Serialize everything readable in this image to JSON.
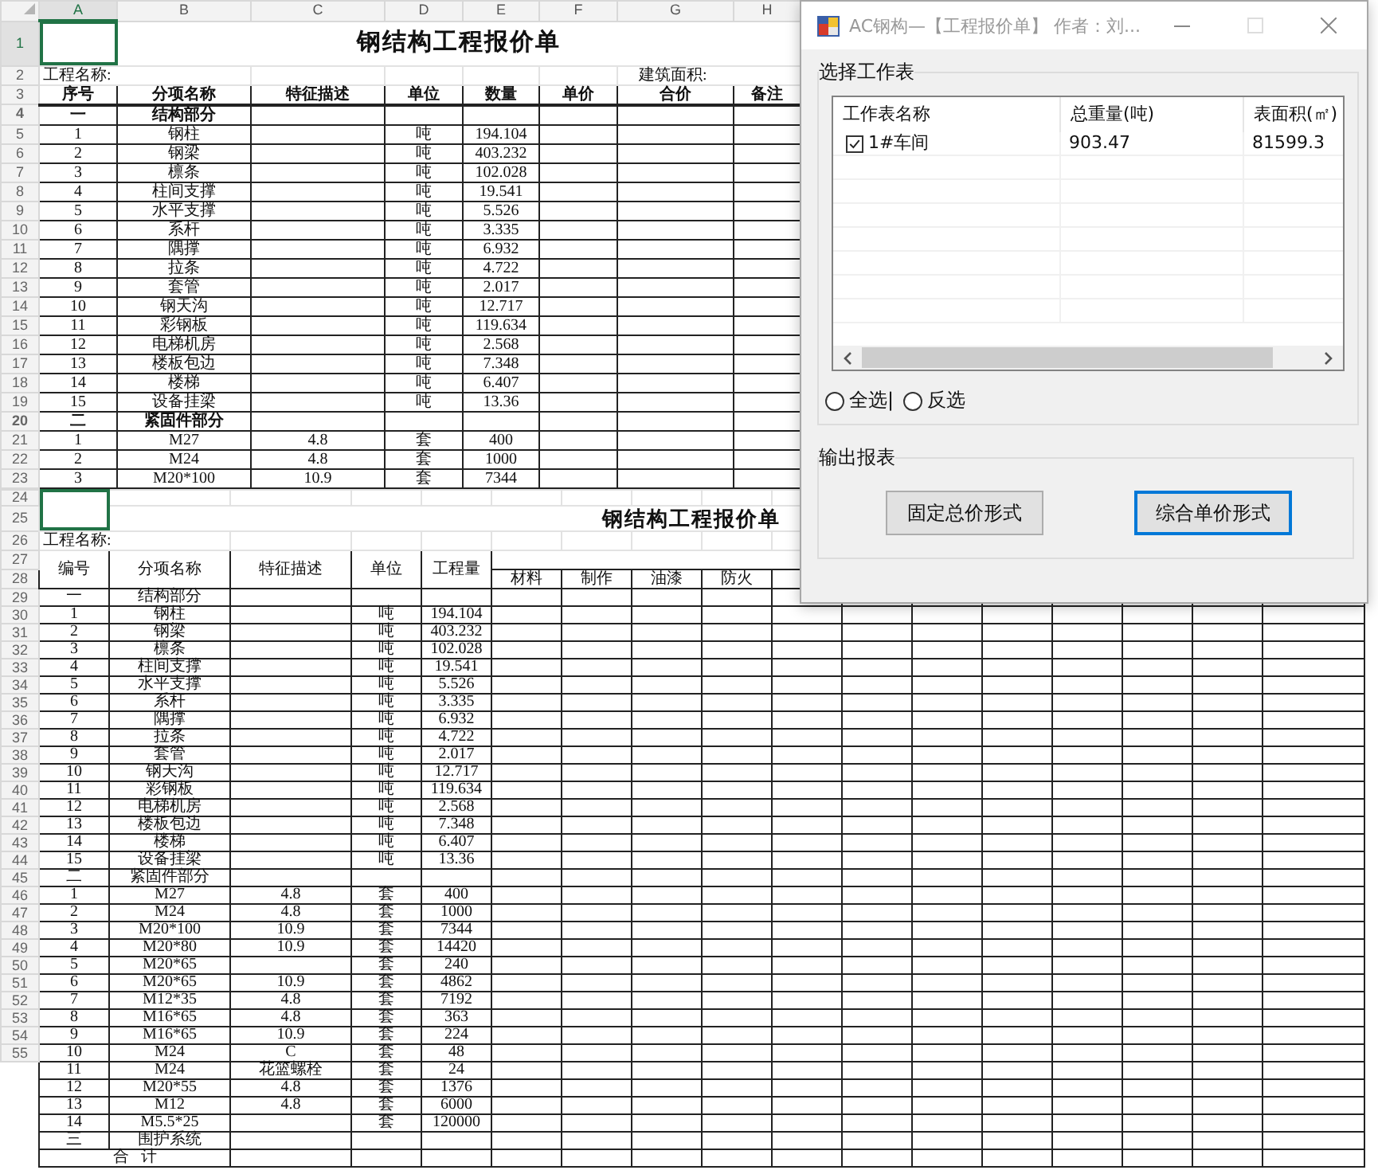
{
  "top_sheet": {
    "column_letters": [
      "A",
      "B",
      "C",
      "D",
      "E",
      "F",
      "G",
      "H"
    ],
    "title_row": {
      "num": "1",
      "text": "钢结构工程报价单"
    },
    "info_row": {
      "num": "2",
      "project_label": "工程名称:",
      "area_label": "建筑面积:"
    },
    "header_row": {
      "num": "3",
      "labels": [
        "序号",
        "分项名称",
        "特征描述",
        "单位",
        "数量",
        "单价",
        "合价",
        "备注"
      ]
    },
    "rows": [
      {
        "num": "4",
        "kind": "section",
        "no": "一",
        "name": "结构部分"
      },
      {
        "num": "5",
        "kind": "item",
        "no": "1",
        "name": "钢柱",
        "unit": "吨",
        "qty": "194.104"
      },
      {
        "num": "6",
        "kind": "item",
        "no": "2",
        "name": "钢梁",
        "unit": "吨",
        "qty": "403.232"
      },
      {
        "num": "7",
        "kind": "item",
        "no": "3",
        "name": "檩条",
        "unit": "吨",
        "qty": "102.028"
      },
      {
        "num": "8",
        "kind": "item",
        "no": "4",
        "name": "柱间支撑",
        "unit": "吨",
        "qty": "19.541"
      },
      {
        "num": "9",
        "kind": "item",
        "no": "5",
        "name": "水平支撑",
        "unit": "吨",
        "qty": "5.526"
      },
      {
        "num": "10",
        "kind": "item",
        "no": "6",
        "name": "系杆",
        "unit": "吨",
        "qty": "3.335"
      },
      {
        "num": "11",
        "kind": "item",
        "no": "7",
        "name": "隅撑",
        "unit": "吨",
        "qty": "6.932"
      },
      {
        "num": "12",
        "kind": "item",
        "no": "8",
        "name": "拉条",
        "unit": "吨",
        "qty": "4.722"
      },
      {
        "num": "13",
        "kind": "item",
        "no": "9",
        "name": "套管",
        "unit": "吨",
        "qty": "2.017"
      },
      {
        "num": "14",
        "kind": "item",
        "no": "10",
        "name": "钢天沟",
        "unit": "吨",
        "qty": "12.717"
      },
      {
        "num": "15",
        "kind": "item",
        "no": "11",
        "name": "彩钢板",
        "unit": "吨",
        "qty": "119.634"
      },
      {
        "num": "16",
        "kind": "item",
        "no": "12",
        "name": "电梯机房",
        "unit": "吨",
        "qty": "2.568"
      },
      {
        "num": "17",
        "kind": "item",
        "no": "13",
        "name": "楼板包边",
        "unit": "吨",
        "qty": "7.348"
      },
      {
        "num": "18",
        "kind": "item",
        "no": "14",
        "name": "楼梯",
        "unit": "吨",
        "qty": "6.407"
      },
      {
        "num": "19",
        "kind": "item",
        "no": "15",
        "name": "设备挂梁",
        "unit": "吨",
        "qty": "13.36"
      },
      {
        "num": "20",
        "kind": "section",
        "no": "二",
        "name": "紧固件部分"
      },
      {
        "num": "21",
        "kind": "item",
        "no": "1",
        "name": "M27",
        "spec": "4.8",
        "unit": "套",
        "qty": "400"
      },
      {
        "num": "22",
        "kind": "item",
        "no": "2",
        "name": "M24",
        "spec": "4.8",
        "unit": "套",
        "qty": "1000"
      },
      {
        "num": "23",
        "kind": "item",
        "no": "3",
        "name": "M20*100",
        "spec": "10.9",
        "unit": "套",
        "qty": "7344"
      }
    ]
  },
  "bottom_sheet": {
    "top_row_numbers": [
      "24",
      "25",
      "26",
      "27",
      "28"
    ],
    "title": "钢结构工程报价单",
    "project_label": "工程名称:",
    "headers": [
      "编号",
      "分项名称",
      "特征描述",
      "单位",
      "工程量"
    ],
    "sub_headers": [
      "材料",
      "制作",
      "油漆",
      "防火"
    ],
    "rows": [
      {
        "num": "29",
        "kind": "line",
        "no": "一",
        "name": "结构部分"
      },
      {
        "num": "30",
        "kind": "line",
        "no": "1",
        "name": "钢柱",
        "unit": "吨",
        "qty": "194.104"
      },
      {
        "num": "31",
        "kind": "line",
        "no": "2",
        "name": "钢梁",
        "unit": "吨",
        "qty": "403.232"
      },
      {
        "num": "32",
        "kind": "line",
        "no": "3",
        "name": "檩条",
        "unit": "吨",
        "qty": "102.028"
      },
      {
        "num": "33",
        "kind": "line",
        "no": "4",
        "name": "柱间支撑",
        "unit": "吨",
        "qty": "19.541"
      },
      {
        "num": "34",
        "kind": "line",
        "no": "5",
        "name": "水平支撑",
        "unit": "吨",
        "qty": "5.526"
      },
      {
        "num": "35",
        "kind": "line",
        "no": "6",
        "name": "系杆",
        "unit": "吨",
        "qty": "3.335"
      },
      {
        "num": "36",
        "kind": "line",
        "no": "7",
        "name": "隅撑",
        "unit": "吨",
        "qty": "6.932"
      },
      {
        "num": "37",
        "kind": "line",
        "no": "8",
        "name": "拉条",
        "unit": "吨",
        "qty": "4.722"
      },
      {
        "num": "38",
        "kind": "line",
        "no": "9",
        "name": "套管",
        "unit": "吨",
        "qty": "2.017"
      },
      {
        "num": "39",
        "kind": "line",
        "no": "10",
        "name": "钢天沟",
        "unit": "吨",
        "qty": "12.717"
      },
      {
        "num": "40",
        "kind": "line",
        "no": "11",
        "name": "彩钢板",
        "unit": "吨",
        "qty": "119.634"
      },
      {
        "num": "41",
        "kind": "line",
        "no": "12",
        "name": "电梯机房",
        "unit": "吨",
        "qty": "2.568"
      },
      {
        "num": "42",
        "kind": "line",
        "no": "13",
        "name": "楼板包边",
        "unit": "吨",
        "qty": "7.348"
      },
      {
        "num": "43",
        "kind": "line",
        "no": "14",
        "name": "楼梯",
        "unit": "吨",
        "qty": "6.407"
      },
      {
        "num": "44",
        "kind": "line",
        "no": "15",
        "name": "设备挂梁",
        "unit": "吨",
        "qty": "13.36"
      },
      {
        "num": "45",
        "kind": "line",
        "no": "二",
        "name": "紧固件部分"
      },
      {
        "num": "46",
        "kind": "line",
        "no": "1",
        "name": "M27",
        "spec": "4.8",
        "unit": "套",
        "qty": "400"
      },
      {
        "num": "47",
        "kind": "line",
        "no": "2",
        "name": "M24",
        "spec": "4.8",
        "unit": "套",
        "qty": "1000"
      },
      {
        "num": "48",
        "kind": "line",
        "no": "3",
        "name": "M20*100",
        "spec": "10.9",
        "unit": "套",
        "qty": "7344"
      },
      {
        "num": "49",
        "kind": "line",
        "no": "4",
        "name": "M20*80",
        "spec": "10.9",
        "unit": "套",
        "qty": "14420"
      },
      {
        "num": "50",
        "kind": "line",
        "no": "5",
        "name": "M20*65",
        "unit": "套",
        "qty": "240"
      },
      {
        "num": "51",
        "kind": "line",
        "no": "6",
        "name": "M20*65",
        "spec": "10.9",
        "unit": "套",
        "qty": "4862"
      },
      {
        "num": "52",
        "kind": "line",
        "no": "7",
        "name": "M12*35",
        "spec": "4.8",
        "unit": "套",
        "qty": "7192"
      },
      {
        "num": "53",
        "kind": "line",
        "no": "8",
        "name": "M16*65",
        "spec": "4.8",
        "unit": "套",
        "qty": "363"
      },
      {
        "num": "54",
        "kind": "line",
        "no": "9",
        "name": "M16*65",
        "spec": "10.9",
        "unit": "套",
        "qty": "224"
      },
      {
        "num": "55",
        "kind": "line",
        "no": "10",
        "name": "M24",
        "spec": "C",
        "unit": "套",
        "qty": "48"
      },
      {
        "kind": "line",
        "no": "11",
        "name": "M24",
        "spec": "花篮螺栓",
        "unit": "套",
        "qty": "24"
      },
      {
        "kind": "line",
        "no": "12",
        "name": "M20*55",
        "spec": "4.8",
        "unit": "套",
        "qty": "1376"
      },
      {
        "kind": "line",
        "no": "13",
        "name": "M12",
        "spec": "4.8",
        "unit": "套",
        "qty": "6000"
      },
      {
        "kind": "line",
        "no": "14",
        "name": "M5.5*25",
        "unit": "套",
        "qty": "120000"
      },
      {
        "kind": "line",
        "no": "三",
        "name": "围护系统"
      },
      {
        "kind": "total",
        "name": "合   计"
      }
    ]
  },
  "dialog": {
    "title": "AC钢构—【工程报价单】 作者：刘...",
    "sheet_group": {
      "title": "选择工作表",
      "columns": [
        "工作表名称",
        "总重量(吨)",
        "表面积(㎡)"
      ],
      "rows": [
        {
          "name": "1#车间",
          "checked": true,
          "weight": "903.47",
          "area": "81599.3"
        }
      ]
    },
    "selection_options": [
      {
        "label": "全选|",
        "selected": false
      },
      {
        "label": "反选",
        "selected": false
      }
    ],
    "output_group": {
      "title": "输出报表",
      "buttons": [
        {
          "label": "固定总价形式",
          "focused": false
        },
        {
          "label": "综合单价形式",
          "focused": true
        }
      ]
    }
  }
}
